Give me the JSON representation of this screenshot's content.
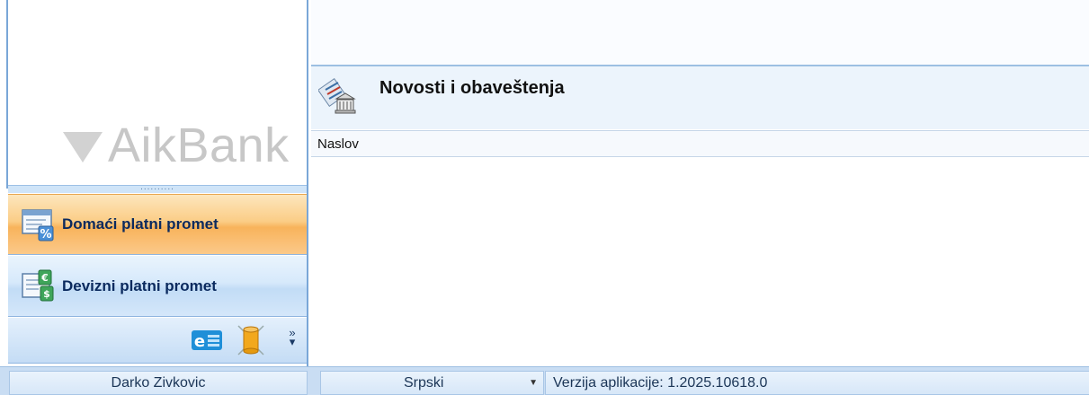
{
  "brand": {
    "logo_text": "AikBank"
  },
  "sidebar": {
    "splitter_dots": "..........",
    "items": [
      {
        "label": "Domaći platni promet",
        "icon": "domestic-payment-icon",
        "active": true
      },
      {
        "label": "Devizni platni promet",
        "icon": "foreign-payment-icon",
        "active": false
      }
    ],
    "toolbar": {
      "more_glyph": "»"
    }
  },
  "news": {
    "title": "Novosti i obaveštenja",
    "columns": [
      "Naslov"
    ],
    "rows": []
  },
  "status_bar": {
    "user": "Darko Zivkovic",
    "language": "Srpski",
    "version": "Verzija aplikacije: 1.2025.10618.0"
  },
  "colors": {
    "active_nav": "#f8b35b",
    "inactive_nav": "#d6e9fb",
    "status_bar": "#c9ddf3",
    "accent_border": "#7aa7d8"
  }
}
